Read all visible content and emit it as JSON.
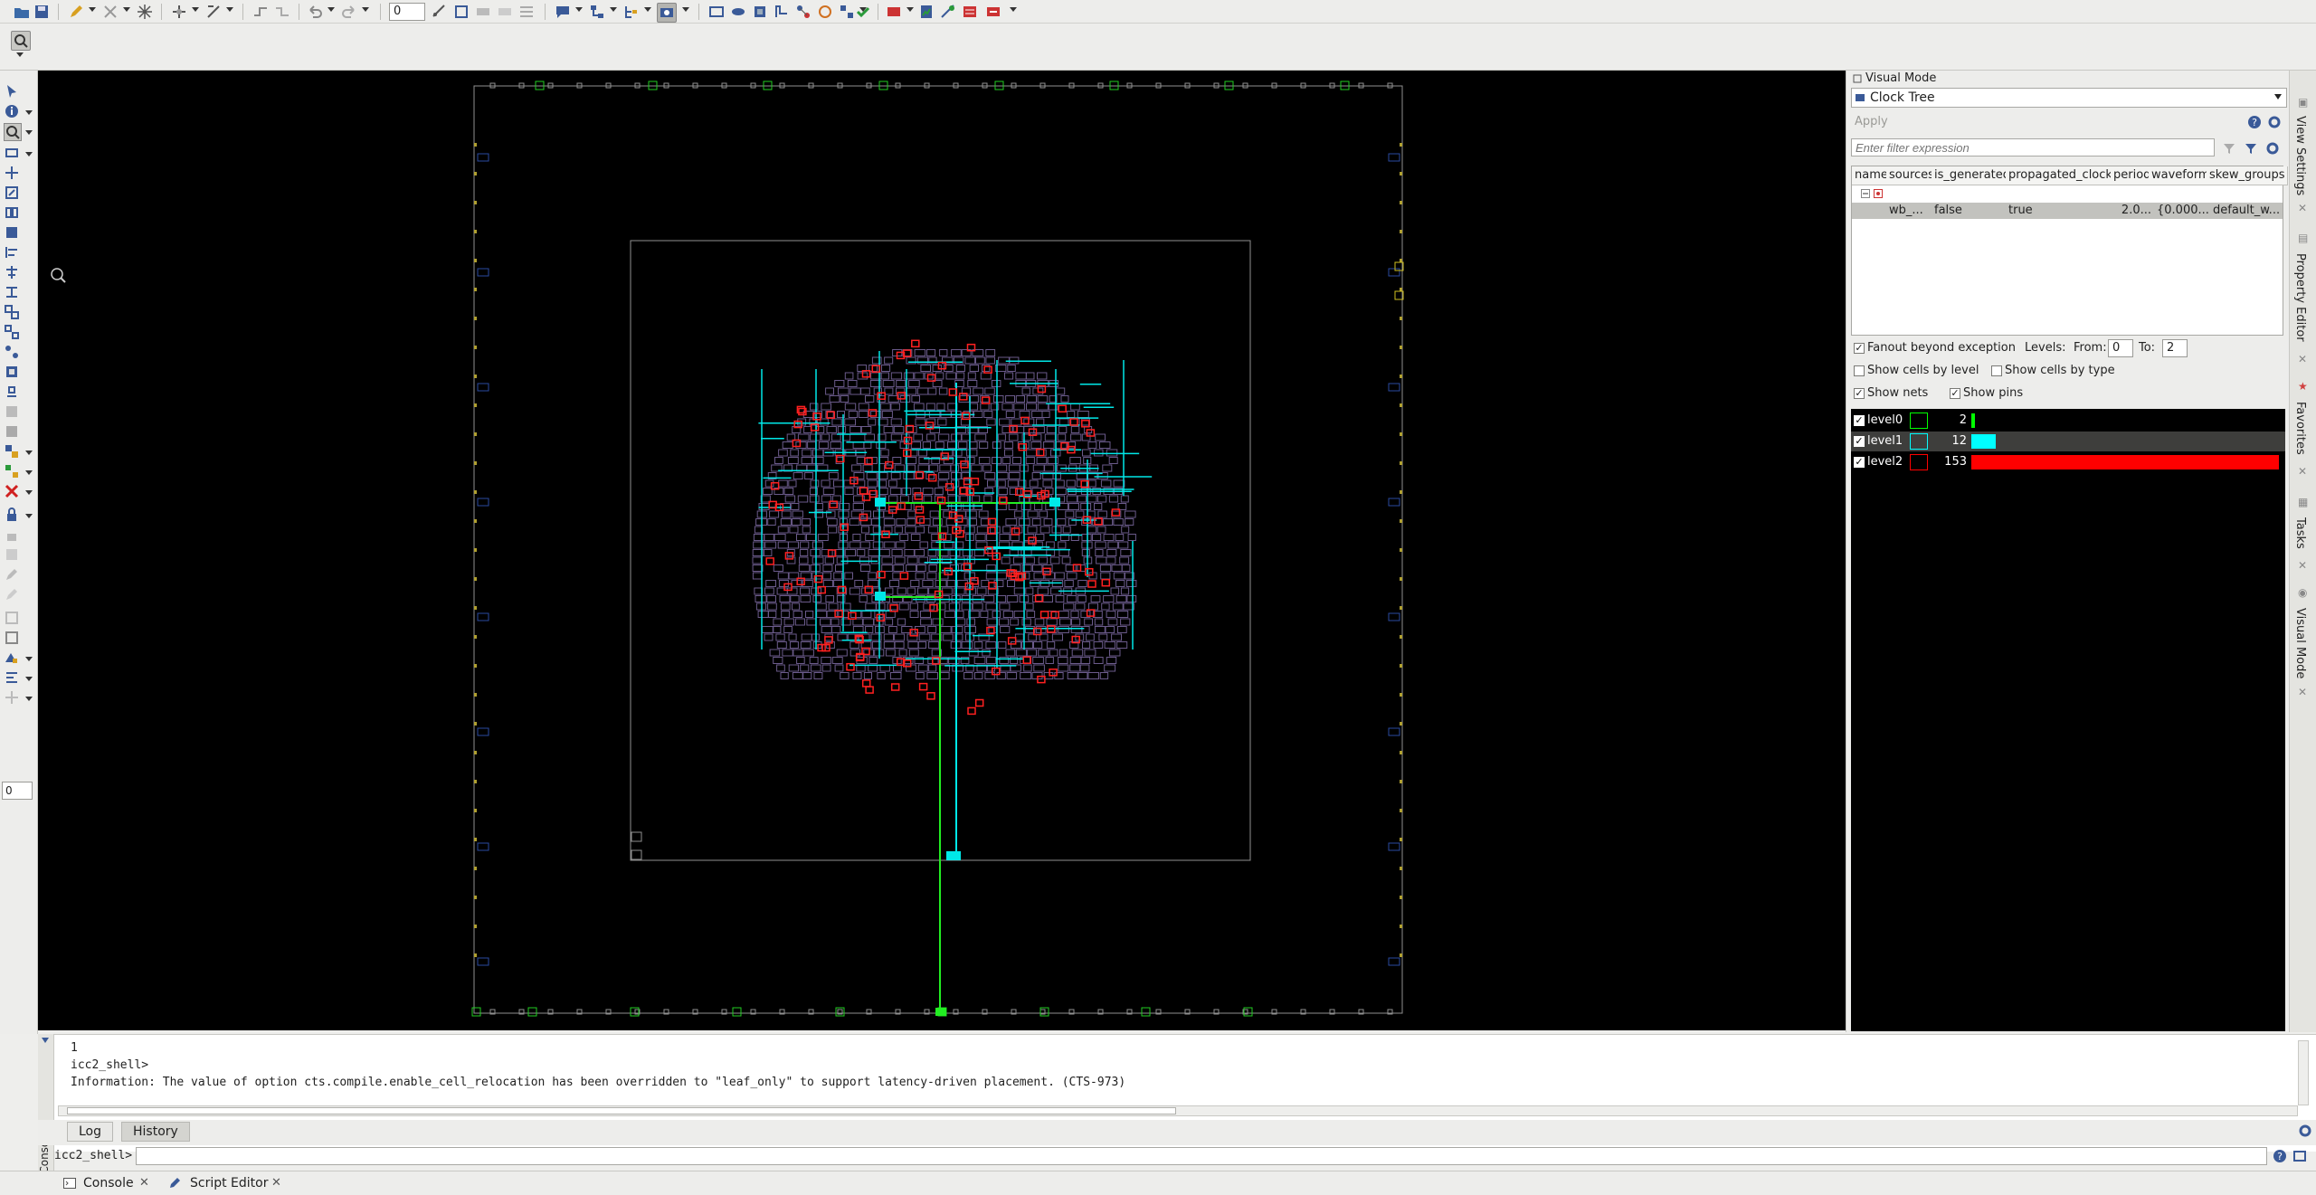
{
  "toolbar": {
    "zoom_value": "0"
  },
  "left_tools": {
    "level_value": "0"
  },
  "right_panel": {
    "title": "Visual Mode",
    "mode": "Clock Tree",
    "apply": "Apply",
    "filter_placeholder": "Enter filter expression",
    "columns": [
      "name",
      "sources",
      "is_generated",
      "propagated_clock",
      "period",
      "waveform",
      "skew_groups"
    ],
    "row": {
      "name": "wb_...",
      "sources": "",
      "is_generated": "false",
      "propagated_clock": "true",
      "period": "2.0...",
      "waveform": "{0.000...",
      "skew_groups": "default_w..."
    },
    "fanout_beyond_exception": "Fanout beyond exception",
    "levels_label": "Levels:",
    "from_label": "From:",
    "from_value": "0",
    "to_label": "To:",
    "to_value": "2",
    "show_cells_by_level": "Show cells by level",
    "show_cells_by_type": "Show cells by type",
    "show_nets": "Show nets",
    "show_pins": "Show pins",
    "levels": [
      {
        "name": "level0",
        "count": "2",
        "color": "#00ff00",
        "fraction": 0.013
      },
      {
        "name": "level1",
        "count": "12",
        "color": "#00ffff",
        "fraction": 0.0784
      },
      {
        "name": "level2",
        "count": "153",
        "color": "#ff0000",
        "fraction": 1.0
      }
    ]
  },
  "side_tabs": [
    "View Settings",
    "Property Editor",
    "Favorites",
    "Tasks",
    "Visual Mode"
  ],
  "console": {
    "lines": [
      "1",
      "icc2_shell>",
      "Information: The value of option cts.compile.enable_cell_relocation has been overridden to \"leaf_only\" to support latency-driven placement. (CTS-973)"
    ],
    "tabs": [
      "Log",
      "History"
    ],
    "prompt": "icc2_shell>",
    "vertical_label": "Console"
  },
  "bottom_tabs": [
    "Console",
    "Script Editor"
  ]
}
